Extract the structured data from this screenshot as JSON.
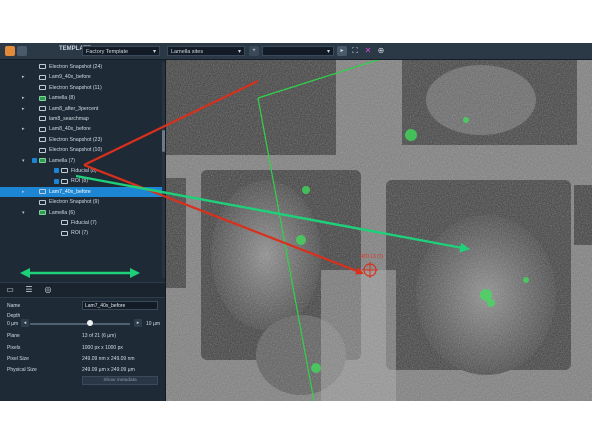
{
  "toolbar": {
    "template_label": "TEMPLATE",
    "template_value": "Factory Template",
    "layer_value": "Lamella sites",
    "plus_label": "+",
    "play_label": "▸"
  },
  "tree": {
    "rows": [
      {
        "label": "Electron Snapshot (24)",
        "icon": "image",
        "indent": 1,
        "arrow": false,
        "check": false,
        "selected": false
      },
      {
        "label": "Lam9_40x_before",
        "icon": "image",
        "indent": 1,
        "arrow": true,
        "check": false,
        "selected": false
      },
      {
        "label": "Electron Snapshot (11)",
        "icon": "image",
        "indent": 1,
        "arrow": false,
        "check": false,
        "selected": false
      },
      {
        "label": "Lamella (8)",
        "icon": "lamella",
        "indent": 1,
        "arrow": true,
        "check": false,
        "selected": false
      },
      {
        "label": "Lam8_after_3percent",
        "icon": "image",
        "indent": 1,
        "arrow": true,
        "check": false,
        "selected": false
      },
      {
        "label": "lam8_searchmap",
        "icon": "image",
        "indent": 1,
        "arrow": false,
        "check": false,
        "selected": false
      },
      {
        "label": "Lam8_40x_before",
        "icon": "image",
        "indent": 1,
        "arrow": true,
        "check": false,
        "selected": false
      },
      {
        "label": "Electron Snapshot (23)",
        "icon": "image",
        "indent": 1,
        "arrow": false,
        "check": false,
        "selected": false
      },
      {
        "label": "Electron Snapshot (10)",
        "icon": "image",
        "indent": 1,
        "arrow": false,
        "check": false,
        "selected": false
      },
      {
        "label": "Lamella (7)",
        "icon": "lamella",
        "indent": 1,
        "arrow": "down",
        "check": true,
        "selected": false
      },
      {
        "label": "Fiducial (8)",
        "icon": "image",
        "indent": 2,
        "arrow": false,
        "check": true,
        "selected": false
      },
      {
        "label": "ROI (8)",
        "icon": "image",
        "indent": 2,
        "arrow": false,
        "check": true,
        "selected": false
      },
      {
        "label": "Lam7_40x_before",
        "icon": "image",
        "indent": 1,
        "arrow": true,
        "check": true,
        "selected": true
      },
      {
        "label": "Electron Snapshot (9)",
        "icon": "image",
        "indent": 1,
        "arrow": false,
        "check": false,
        "selected": false
      },
      {
        "label": "Lamella (6)",
        "icon": "lamella",
        "indent": 1,
        "arrow": "down",
        "check": false,
        "selected": false
      },
      {
        "label": "Fiducial (7)",
        "icon": "image",
        "indent": 2,
        "arrow": false,
        "check": false,
        "selected": false
      },
      {
        "label": "ROI (7)",
        "icon": "image",
        "indent": 2,
        "arrow": false,
        "check": false,
        "selected": false
      }
    ]
  },
  "properties": {
    "name_label": "Name",
    "name_value": "Lam7_40x_before",
    "depth_label": "Depth",
    "depth_min": "0 µm",
    "depth_max": "10 µm",
    "depth_fraction": 0.6,
    "plane_label": "Plane",
    "plane_value": "13 of 21 (6 µm)",
    "pixels_label": "Pixels",
    "pixels_value": "1000 px x 1000 px",
    "pixel_size_label": "Pixel Size",
    "pixel_size_value": "249.09 nm x 249.09 nm",
    "physical_size_label": "Physical Size",
    "physical_size_value": "249.09 µm x 249.09 µm",
    "metadata_button": "Show metadata"
  },
  "viewer": {
    "roi_label": "ROI 13 (7)",
    "colors": {
      "red_arrow": "#d8301c",
      "green_arrow": "#1fd07a",
      "roi_frame": "#2fd24a",
      "selection": "#1d86d4"
    }
  }
}
